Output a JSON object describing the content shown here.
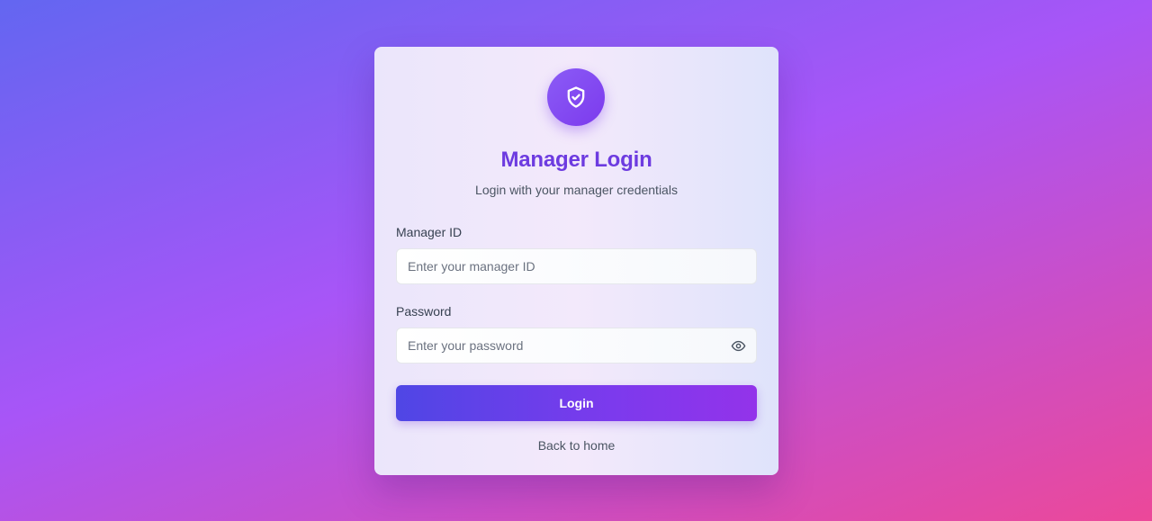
{
  "login": {
    "title": "Manager Login",
    "subtitle": "Login with your manager credentials",
    "manager_id_label": "Manager ID",
    "manager_id_placeholder": "Enter your manager ID",
    "manager_id_value": "",
    "password_label": "Password",
    "password_placeholder": "Enter your password",
    "password_value": "",
    "submit_label": "Login",
    "back_link": "Back to home"
  },
  "icons": {
    "logo": "shield-check-icon",
    "password_toggle": "eye-icon"
  },
  "colors": {
    "accent": "#6d3be0",
    "button_start": "#4f46e5",
    "button_end": "#9333ea",
    "background_start": "#6366f1",
    "background_mid": "#a855f7",
    "background_end": "#ec4899"
  }
}
